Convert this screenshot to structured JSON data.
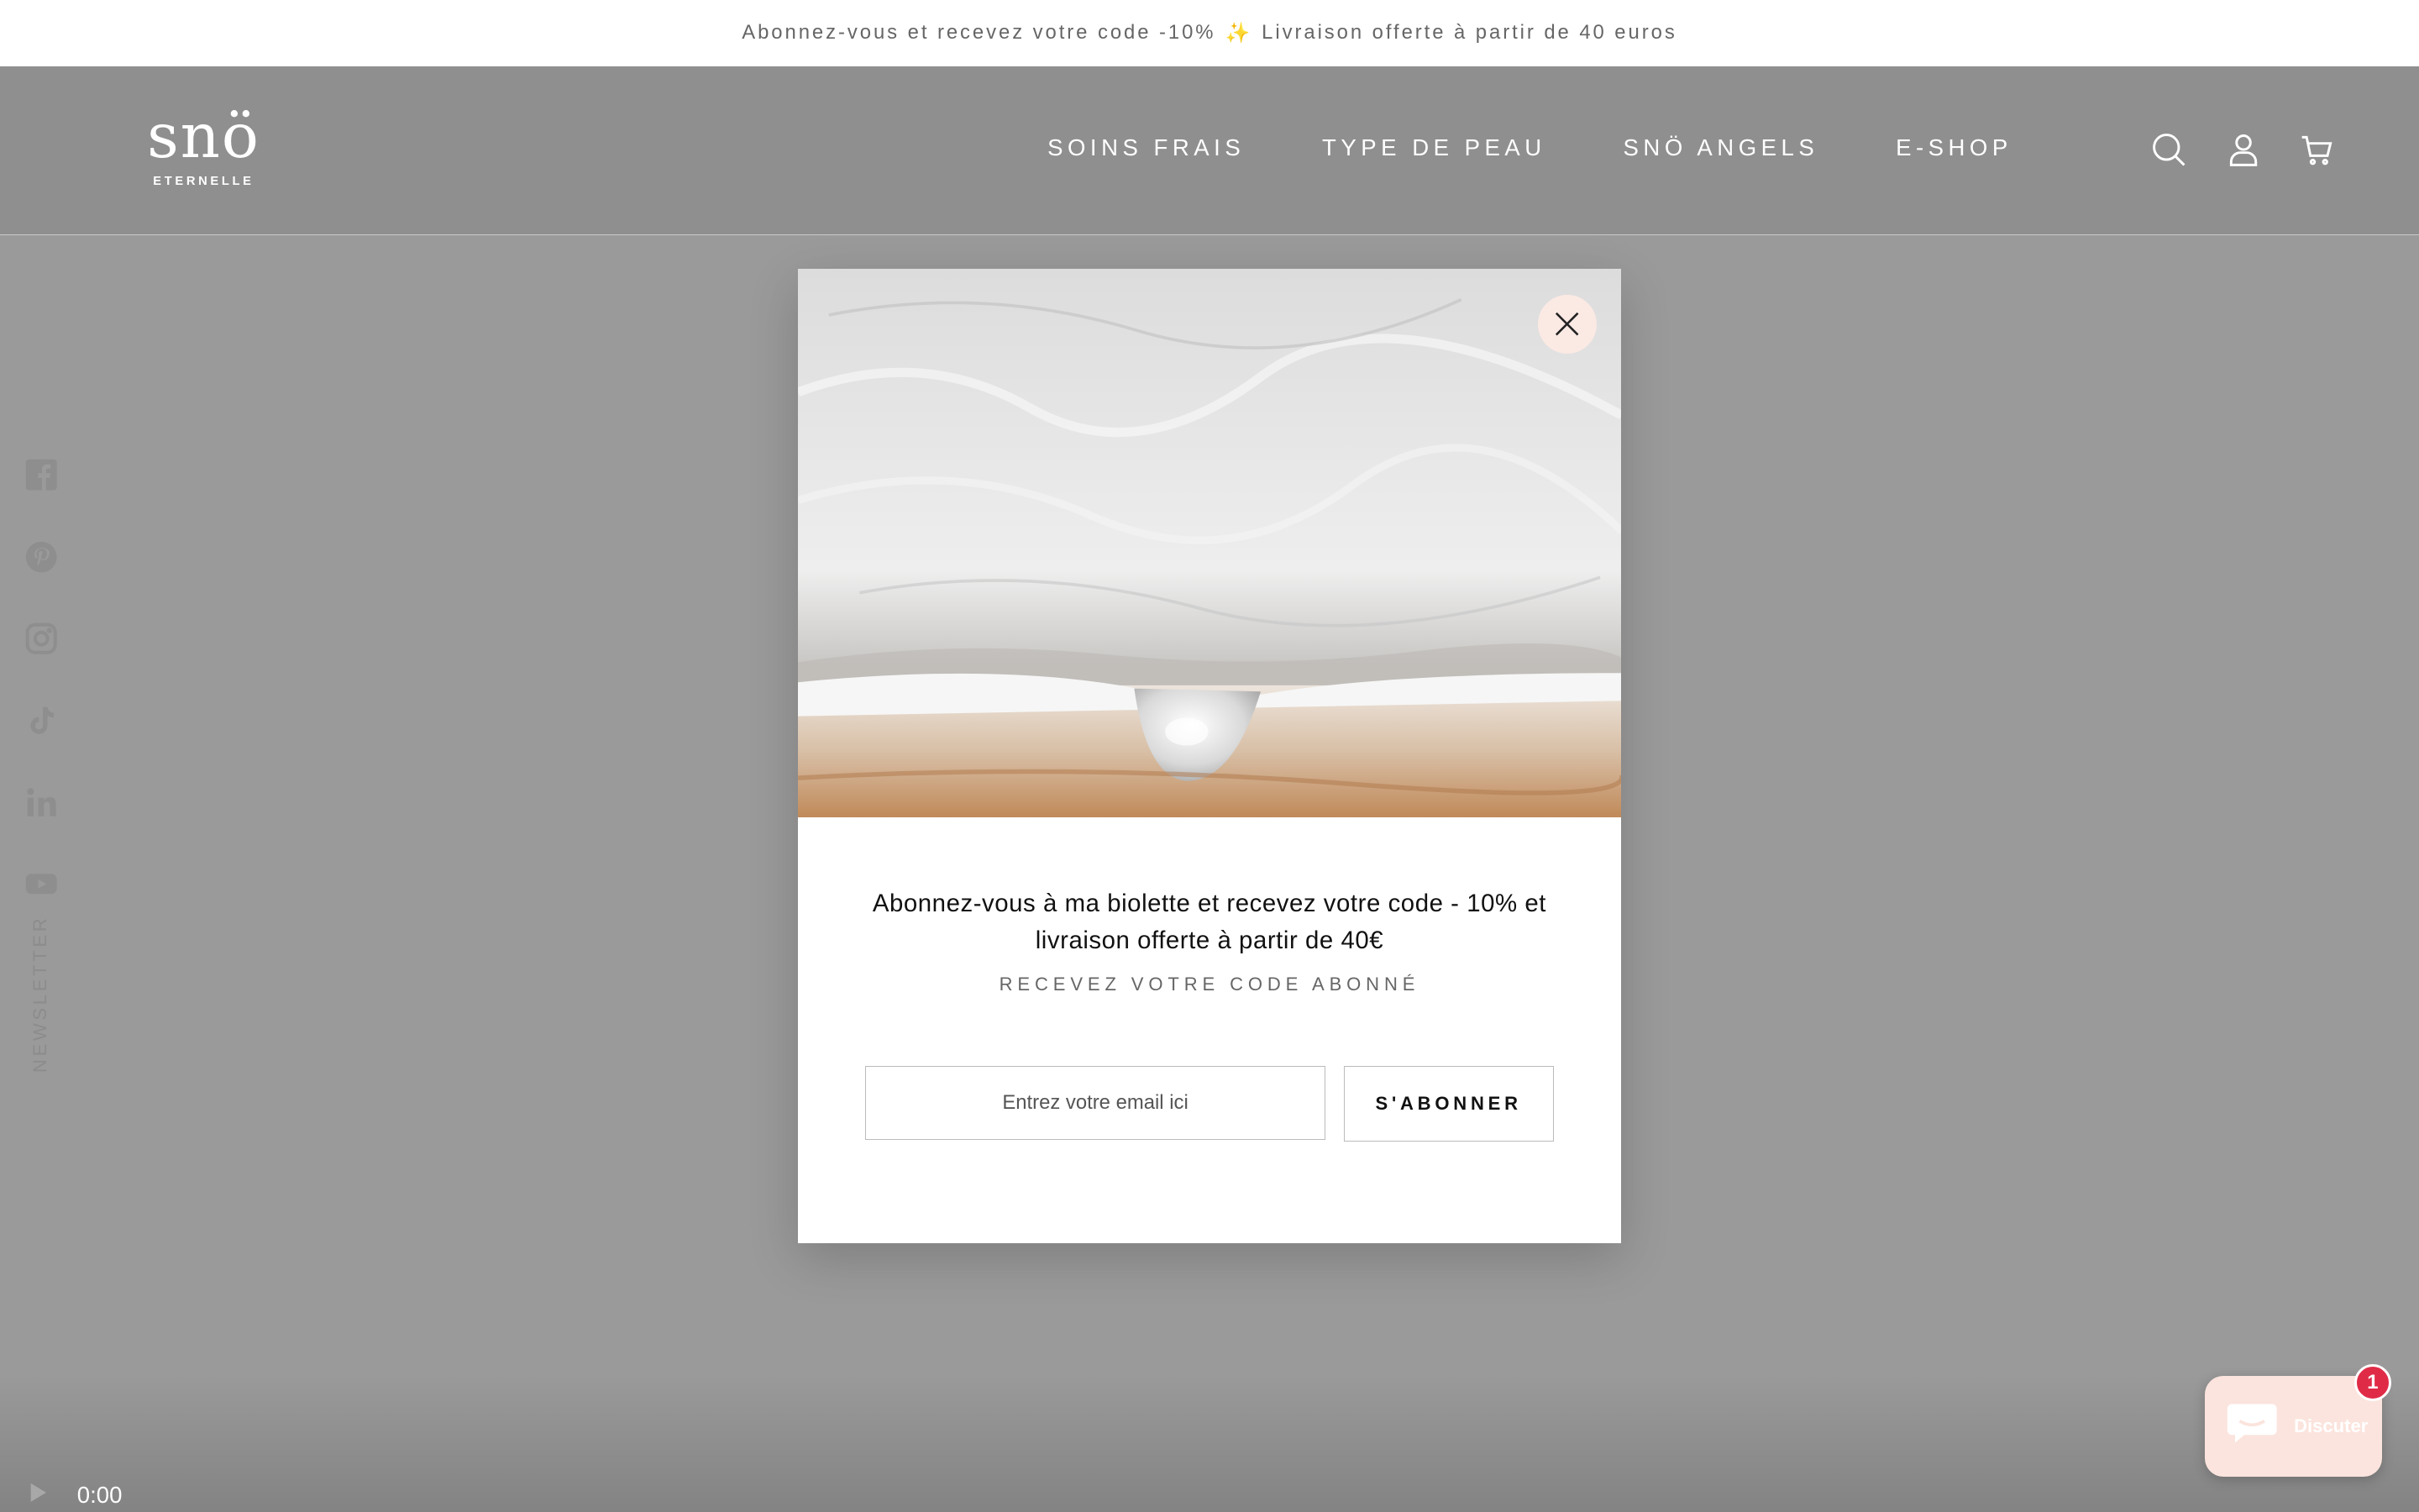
{
  "announcement": {
    "part1": "Abonnez-vous et recevez votre code -10%",
    "sparkle": "✨",
    "part2": "Livraison offerte à partir de 40 euros"
  },
  "brand": {
    "name": "snö",
    "tagline": "ETERNELLE"
  },
  "nav": {
    "items": [
      {
        "label": "SOINS FRAIS"
      },
      {
        "label": "TYPE DE PEAU"
      },
      {
        "label": "SNÖ ANGELS"
      },
      {
        "label": "E-SHOP"
      }
    ]
  },
  "header_icons": [
    "search-icon",
    "account-icon",
    "cart-icon"
  ],
  "social": {
    "icons": [
      "facebook-icon",
      "pinterest-icon",
      "instagram-icon",
      "tiktok-icon",
      "linkedin-icon",
      "youtube-icon"
    ],
    "newsletter_label": "NEWSLETTER"
  },
  "video": {
    "time": "0:00"
  },
  "popup": {
    "headline": "Abonnez-vous à ma biolette et recevez votre code - 10% et livraison offerte à partir de 40€",
    "subheading": "RECEVEZ VOTRE CODE ABONNÉ",
    "email_placeholder": "Entrez votre email ici",
    "subscribe_label": "S'ABONNER"
  },
  "chat": {
    "label": "Discuter",
    "badge": "1"
  },
  "colors": {
    "overlay": "#9a9a9a",
    "close_bg": "#fbe9e4",
    "chat_bg": "#fbe4dd",
    "badge": "#e02b47",
    "sparkle": "#e8c35a"
  }
}
